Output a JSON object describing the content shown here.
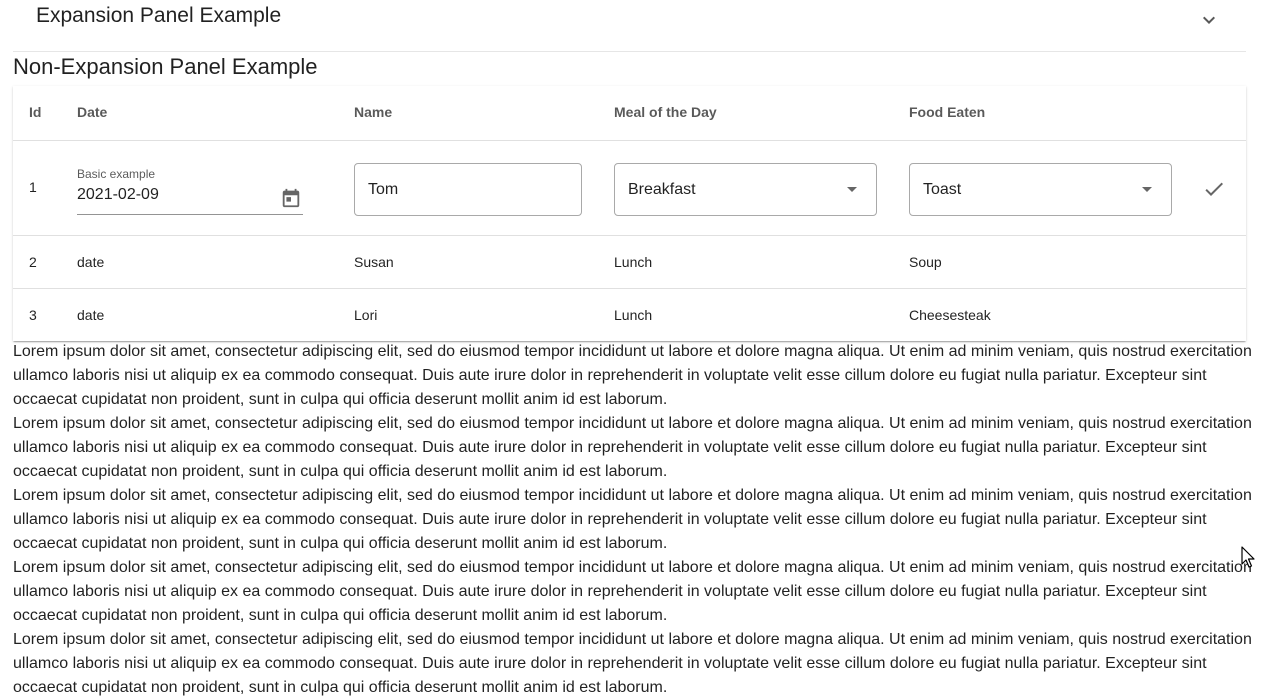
{
  "expansion_panel": {
    "title": "Expansion Panel Example",
    "icon": "chevron-down-icon"
  },
  "section": {
    "title": "Non-Expansion Panel Example"
  },
  "table": {
    "headers": {
      "id": "Id",
      "date": "Date",
      "name": "Name",
      "meal": "Meal of the Day",
      "food": "Food Eaten"
    },
    "edit_row": {
      "id": "1",
      "date_label": "Basic example",
      "date_value": "2021-02-09",
      "name_value": "Tom",
      "meal_value": "Breakfast",
      "food_value": "Toast"
    },
    "rows": [
      {
        "id": "2",
        "date": "date",
        "name": "Susan",
        "meal": "Lunch",
        "food": "Soup"
      },
      {
        "id": "3",
        "date": "date",
        "name": "Lori",
        "meal": "Lunch",
        "food": "Cheesesteak"
      }
    ]
  },
  "paragraphs": [
    "Lorem ipsum dolor sit amet, consectetur adipiscing elit, sed do eiusmod tempor incididunt ut labore et dolore magna aliqua. Ut enim ad minim veniam, quis nostrud exercitation ullamco laboris nisi ut aliquip ex ea commodo consequat. Duis aute irure dolor in reprehenderit in voluptate velit esse cillum dolore eu fugiat nulla pariatur. Excepteur sint occaecat cupidatat non proident, sunt in culpa qui officia deserunt mollit anim id est laborum.",
    "Lorem ipsum dolor sit amet, consectetur adipiscing elit, sed do eiusmod tempor incididunt ut labore et dolore magna aliqua. Ut enim ad minim veniam, quis nostrud exercitation ullamco laboris nisi ut aliquip ex ea commodo consequat. Duis aute irure dolor in reprehenderit in voluptate velit esse cillum dolore eu fugiat nulla pariatur. Excepteur sint occaecat cupidatat non proident, sunt in culpa qui officia deserunt mollit anim id est laborum.",
    "Lorem ipsum dolor sit amet, consectetur adipiscing elit, sed do eiusmod tempor incididunt ut labore et dolore magna aliqua. Ut enim ad minim veniam, quis nostrud exercitation ullamco laboris nisi ut aliquip ex ea commodo consequat. Duis aute irure dolor in reprehenderit in voluptate velit esse cillum dolore eu fugiat nulla pariatur. Excepteur sint occaecat cupidatat non proident, sunt in culpa qui officia deserunt mollit anim id est laborum.",
    "Lorem ipsum dolor sit amet, consectetur adipiscing elit, sed do eiusmod tempor incididunt ut labore et dolore magna aliqua. Ut enim ad minim veniam, quis nostrud exercitation ullamco laboris nisi ut aliquip ex ea commodo consequat. Duis aute irure dolor in reprehenderit in voluptate velit esse cillum dolore eu fugiat nulla pariatur. Excepteur sint occaecat cupidatat non proident, sunt in culpa qui officia deserunt mollit anim id est laborum.",
    "Lorem ipsum dolor sit amet, consectetur adipiscing elit, sed do eiusmod tempor incididunt ut labore et dolore magna aliqua. Ut enim ad minim veniam, quis nostrud exercitation ullamco laboris nisi ut aliquip ex ea commodo consequat. Duis aute irure dolor in reprehenderit in voluptate velit esse cillum dolore eu fugiat nulla pariatur. Excepteur sint occaecat cupidatat non proident, sunt in culpa qui officia deserunt mollit anim id est laborum."
  ],
  "icons": {
    "calendar": "calendar-icon",
    "dropdown": "dropdown-arrow-icon",
    "check": "check-icon",
    "cursor": "mouse-cursor-icon"
  }
}
